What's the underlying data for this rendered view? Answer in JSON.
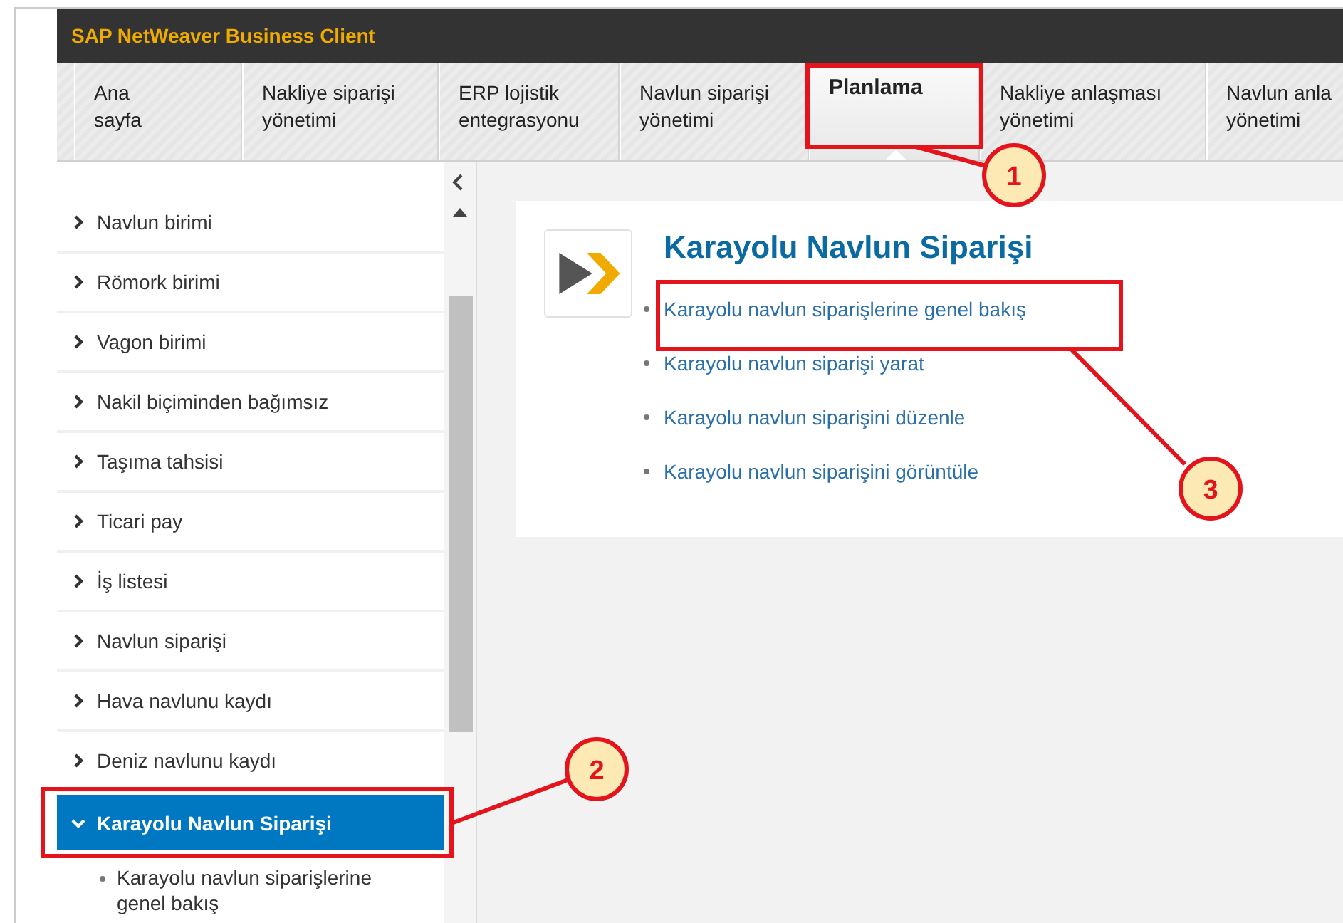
{
  "window": {
    "title": "SAP NetWeaver Business Client"
  },
  "tabs": [
    {
      "label": "Ana\nsayfa",
      "selected": false
    },
    {
      "label": "Nakliye siparişi\nyönetimi",
      "selected": false
    },
    {
      "label": "ERP lojistik\nentegrasyonu",
      "selected": false
    },
    {
      "label": "Navlun siparişi\nyönetimi",
      "selected": false
    },
    {
      "label": "Planlama",
      "selected": true
    },
    {
      "label": "Nakliye anlaşması\nyönetimi",
      "selected": false
    },
    {
      "label": "Navlun anla\nyönetimi",
      "selected": false
    }
  ],
  "sidebar": {
    "items": [
      {
        "label": "Navlun birimi",
        "selected": false,
        "expanded": false
      },
      {
        "label": "Römork birimi",
        "selected": false,
        "expanded": false
      },
      {
        "label": "Vagon birimi",
        "selected": false,
        "expanded": false
      },
      {
        "label": "Nakil biçiminden bağımsız",
        "selected": false,
        "expanded": false
      },
      {
        "label": "Taşıma tahsisi",
        "selected": false,
        "expanded": false
      },
      {
        "label": "Ticari pay",
        "selected": false,
        "expanded": false
      },
      {
        "label": "İş listesi",
        "selected": false,
        "expanded": false
      },
      {
        "label": "Navlun siparişi",
        "selected": false,
        "expanded": false
      },
      {
        "label": "Hava navlunu kaydı",
        "selected": false,
        "expanded": false
      },
      {
        "label": "Deniz navlunu kaydı",
        "selected": false,
        "expanded": false
      },
      {
        "label": "Karayolu Navlun Siparişi",
        "selected": true,
        "expanded": true,
        "children": [
          {
            "label": "Karayolu navlun siparişlerine genel bakış"
          }
        ]
      }
    ]
  },
  "content": {
    "title": "Karayolu Navlun Siparişi",
    "links": [
      "Karayolu navlun siparişlerine genel bakış",
      "Karayolu navlun siparişi yarat",
      "Karayolu navlun siparişini düzenle",
      "Karayolu navlun siparişini görüntüle"
    ]
  },
  "annotations": [
    {
      "number": "1"
    },
    {
      "number": "2"
    },
    {
      "number": "3"
    }
  ]
}
